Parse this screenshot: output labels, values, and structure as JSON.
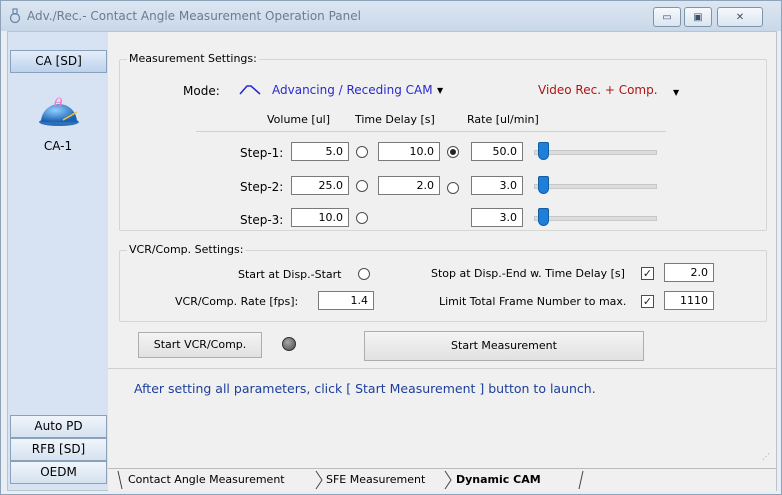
{
  "window": {
    "title": "Adv./Rec.- Contact Angle Measurement Operation Panel",
    "controls": {
      "minimize": "▭",
      "maximize": "▣",
      "close": "✕"
    }
  },
  "sidebar": {
    "top_tab": "CA [SD]",
    "logo_icon": "contact-angle-droplet-icon",
    "logo_label": "CA-1",
    "bottom_tabs": [
      "Auto PD",
      "RFB [SD]",
      "OEDM"
    ]
  },
  "measurement": {
    "group_label": "Measurement Settings:",
    "mode_label": "Mode:",
    "mode_value": "Advancing / Receding  CAM",
    "video_value": "Video Rec. + Comp.",
    "headers": {
      "volume": "Volume [ul]",
      "delay": "Time Delay [s]",
      "rate": "Rate [ul/min]"
    },
    "steps": [
      {
        "label": "Step-1:",
        "volume": "5.0",
        "delay": "10.0",
        "rate": "50.0",
        "radio_a": false,
        "radio_b": true
      },
      {
        "label": "Step-2:",
        "volume": "25.0",
        "delay": "2.0",
        "rate": "3.0",
        "radio_a": false,
        "radio_b": false
      },
      {
        "label": "Step-3:",
        "volume": "10.0",
        "delay": "",
        "rate": "3.0",
        "radio_a": false,
        "radio_b": false
      }
    ]
  },
  "vcr": {
    "group_label": "VCR/Comp. Settings:",
    "start_disp_label": "Start at Disp.-Start",
    "stop_disp_label": "Stop at Disp.-End w. Time Delay [s]",
    "stop_disp_value": "2.0",
    "rate_label": "VCR/Comp. Rate [fps]:",
    "rate_value": "1.4",
    "limit_label": "Limit Total Frame Number to max.",
    "limit_value": "1110"
  },
  "actions": {
    "start_vcr": "Start VCR/Comp.",
    "start_measurement": "Start Measurement",
    "info": "After setting all parameters, click [ Start Measurement ] button to launch."
  },
  "bottom_tabs": [
    "Contact Angle Measurement",
    "SFE Measurement",
    "Dynamic CAM"
  ],
  "colors": {
    "mode_text": "#2a2ad0",
    "video_text": "#b01414",
    "slider": "#1f7fd8",
    "info_text": "#1c3f9a"
  }
}
